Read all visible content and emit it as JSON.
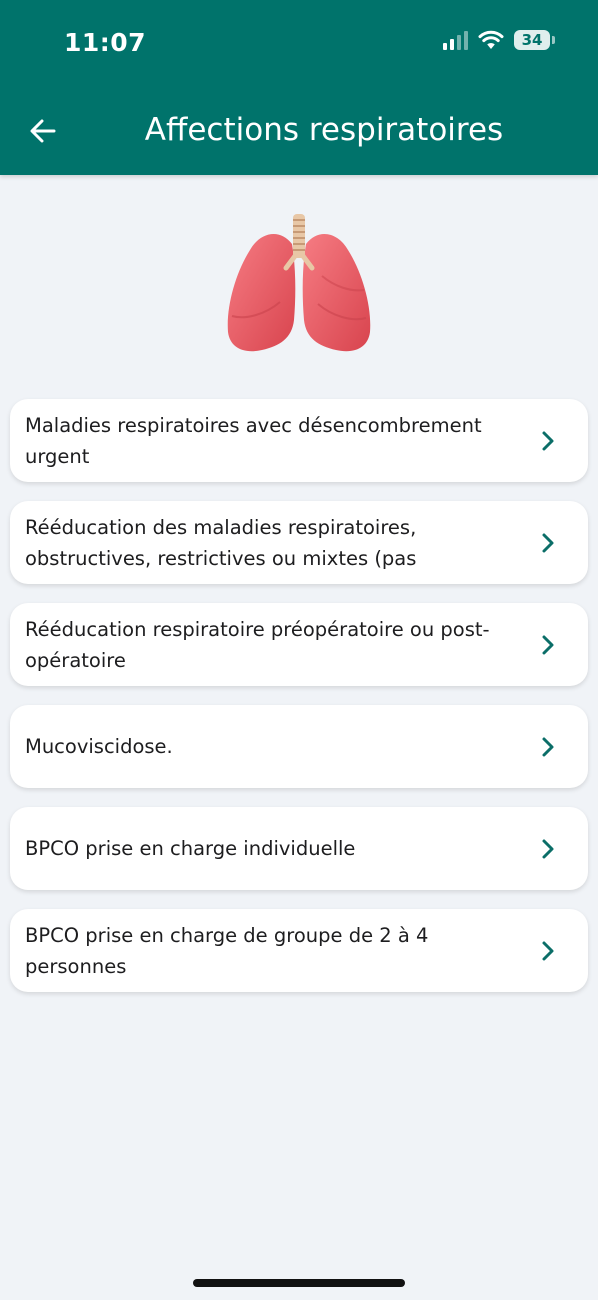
{
  "status": {
    "time": "11:07",
    "battery": "34"
  },
  "header": {
    "title": "Affections respiratoires",
    "back_icon": "arrow-left-icon"
  },
  "hero_icon": "lungs-icon",
  "items": [
    {
      "label": "Maladies respiratoires avec désencombrement urgent"
    },
    {
      "label": "Rééducation des maladies respiratoires, obstructives, restrictives ou mixtes (pas"
    },
    {
      "label": "Rééducation respiratoire préopératoire ou post-opératoire"
    },
    {
      "label": "Mucoviscidose."
    },
    {
      "label": "BPCO prise en charge individuelle"
    },
    {
      "label": "BPCO prise en charge de groupe de 2 à 4 personnes"
    }
  ],
  "colors": {
    "header": "#00736b",
    "background": "#f0f3f7",
    "chevron": "#0b6e68",
    "lung": "#f0646c"
  }
}
